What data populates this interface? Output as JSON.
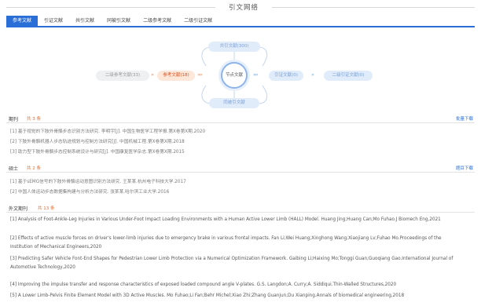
{
  "header": {
    "title": "引文网络"
  },
  "tabs": [
    "参考文献",
    "引证文献",
    "共引文献",
    "同被引文献",
    "二级参考文献",
    "二级引证文献"
  ],
  "diagram": {
    "top": "共引文献(300)",
    "bottom": "同被引文献",
    "left_outer": "二级参考文献(33)",
    "left_inner": "参考文献(18)",
    "center": "节点文献",
    "right_inner": "引证文献(0)",
    "right_outer": "二级引证文献(0)"
  },
  "sections": {
    "journal": {
      "label": "期刊",
      "count": "共 3 条",
      "link": "批量下载"
    },
    "thesis": {
      "label": "硕士",
      "count": "共 2 条",
      "link": "题目下载"
    },
    "foreign": {
      "label": "外文期刊",
      "count": "共 13 条"
    }
  },
  "journal_refs": [
    "[1] 基于视觉的下肢外骨骼步态识别方法研究. 李明宇[J]. 中国生物医学工程学报.第X卷第X期.2020",
    "[2] 下肢外骨骼机器人步态轨迹规划与控制方法研究[J]. 中国机械工程.第X卷第X期.2018",
    "[3] 助力型下肢外骨骼步态控制系统设计与研究[J]. 中国康复医学杂志.第X卷第X期.2015"
  ],
  "thesis_refs": [
    "[1] 基于sEMG信号的下肢外骨骼运动意图识别方法研究. 王某某.杭州电子科技大学.2017",
    "[2] 中国人体运动步态数据集构建与分析方法研究. 张某某.哈尔滨工业大学.2016"
  ],
  "foreign_refs": [
    "[1] Analysis of Foot-Ankle-Leg Injuries in Various Under-Foot Impact Loading Environments with a Human Active Lower Limb (HALL) Model. Huang Jing;Huang Can;Mo Fuhao.J Biomech Eng,2021",
    "[2] Effects of active muscle forces on driver's lower-limb injuries due to emergency brake in various frontal impacts. Fan Li;Wei Huang;Xinghong Wang;Xiaojiang Lv;Fuhao Mo.Proceedings of the Institution of Mechanical Engineers,2020",
    "[3] Predicting Safer Vehicle Font-End Shapes for Pedestrian Lower Limb Protection via a Numerical Optimization Framework. Gaibing Li;Haixing Mo;Tonggi Guan;Guoqiang Gao.International Journal of Automotive Technology,2020",
    "[4] Improving the impulse transfer and response characteristics of exposed loaded compound angle V-plates. G.S. Langdon;A. Curry;A. Siddiqui.Thin-Walled Structures,2020",
    "[5] A Lower Limb-Pelvis Finite Element Model with 3D Active Muscles. Mo Fuhao;Li Fan;Behr Michel;Xiao Zhi;Zhang Guanjun;Du Xianping.Annals of biomedical engineering,2018"
  ],
  "colors": {
    "accent": "#2a6fd8",
    "orange": "#e26a2c"
  }
}
